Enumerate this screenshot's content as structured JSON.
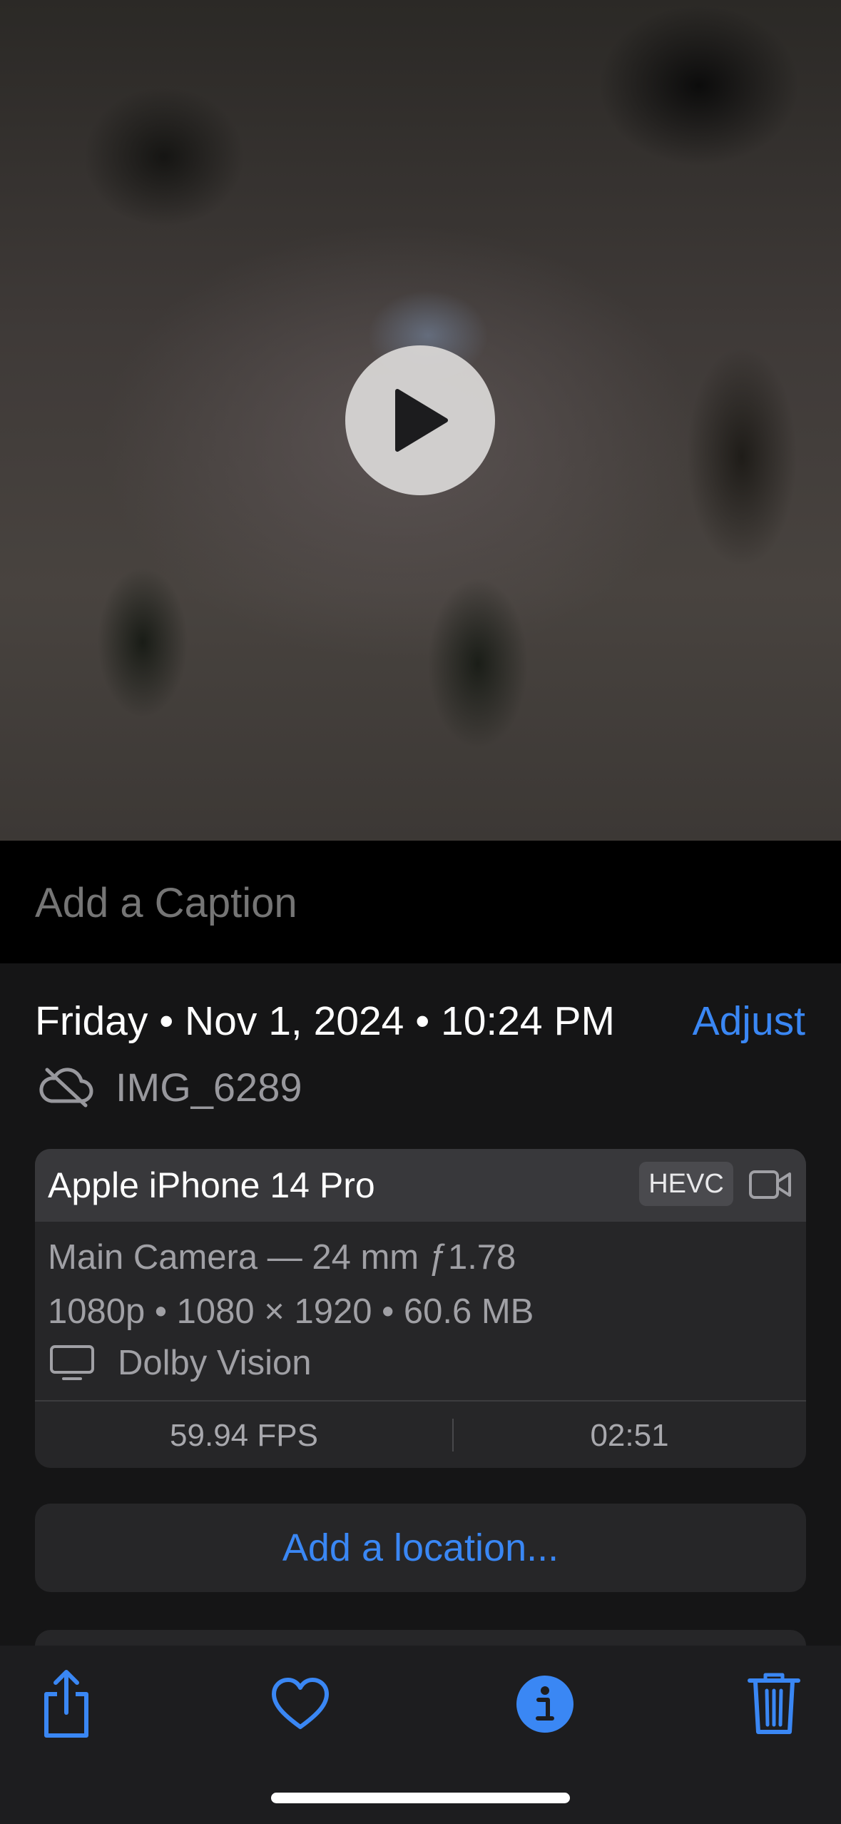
{
  "video": {
    "play_icon": "play-icon"
  },
  "caption": {
    "placeholder": "Add a Caption"
  },
  "info": {
    "date_text": "Friday • Nov 1, 2024 • 10:24 PM",
    "adjust_label": "Adjust",
    "file_icon": "icloud-slash-icon",
    "file_name": "IMG_6289"
  },
  "camera_card": {
    "device": "Apple iPhone 14 Pro",
    "format_badge": "HEVC",
    "format_icon": "video-camera-icon",
    "lens": "Main Camera — 24 mm ƒ1.78",
    "specs": "1080p • 1080 × 1920 • 60.6 MB",
    "display_icon": "monitor-icon",
    "hdr": "Dolby Vision",
    "fps": "59.94 FPS",
    "duration": "02:51"
  },
  "location": {
    "label": "Add a location..."
  },
  "toolbar": {
    "share_icon": "share-icon",
    "favorite_icon": "heart-icon",
    "info_icon": "info-icon",
    "delete_icon": "trash-icon"
  },
  "colors": {
    "accent": "#3a87f4",
    "background": "#151516",
    "card": "#262628"
  }
}
